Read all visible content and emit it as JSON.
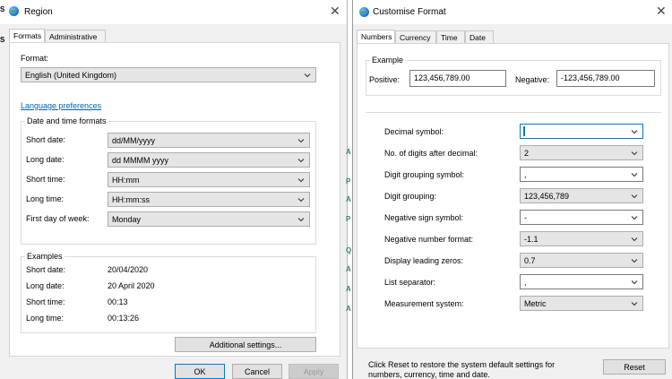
{
  "region": {
    "title": "Region",
    "tabs": [
      "Formats",
      "Administrative"
    ],
    "format_label": "Format:",
    "format_value": "English (United Kingdom)",
    "language_link": "Language preferences",
    "datetime_group": "Date and time formats",
    "rows": [
      {
        "label": "Short date:",
        "value": "dd/MM/yyyy"
      },
      {
        "label": "Long date:",
        "value": "dd MMMM yyyy"
      },
      {
        "label": "Short time:",
        "value": "HH:mm"
      },
      {
        "label": "Long time:",
        "value": "HH:mm:ss"
      },
      {
        "label": "First day of week:",
        "value": "Monday"
      }
    ],
    "examples_group": "Examples",
    "examples": [
      {
        "label": "Short date:",
        "value": "20/04/2020"
      },
      {
        "label": "Long date:",
        "value": "20 April 2020"
      },
      {
        "label": "Short time:",
        "value": "00:13"
      },
      {
        "label": "Long time:",
        "value": "00:13:26"
      }
    ],
    "additional_settings": "Additional settings...",
    "ok": "OK",
    "cancel": "Cancel",
    "apply": "Apply"
  },
  "custom": {
    "title": "Customise Format",
    "tabs": [
      "Numbers",
      "Currency",
      "Time",
      "Date"
    ],
    "example_group": "Example",
    "positive_label": "Positive:",
    "positive_value": "123,456,789.00",
    "negative_label": "Negative:",
    "negative_value": "-123,456,789.00",
    "settings": [
      {
        "label": "Decimal symbol:",
        "value": ""
      },
      {
        "label": "No. of digits after decimal:",
        "value": "2"
      },
      {
        "label": "Digit grouping symbol:",
        "value": ","
      },
      {
        "label": "Digit grouping:",
        "value": "123,456,789"
      },
      {
        "label": "Negative sign symbol:",
        "value": "-"
      },
      {
        "label": "Negative number format:",
        "value": "-1.1"
      },
      {
        "label": "Display leading zeros:",
        "value": "0.7"
      },
      {
        "label": "List separator:",
        "value": ","
      },
      {
        "label": "Measurement system:",
        "value": "Metric"
      }
    ],
    "reset_note": "Click Reset to restore the system default settings for numbers, currency, time and date.",
    "reset": "Reset"
  },
  "background": {
    "left_edge": [
      "S",
      "S"
    ],
    "glyphs": [
      "A",
      "P",
      "A",
      "P",
      "Q",
      "A",
      "A",
      "A"
    ]
  }
}
